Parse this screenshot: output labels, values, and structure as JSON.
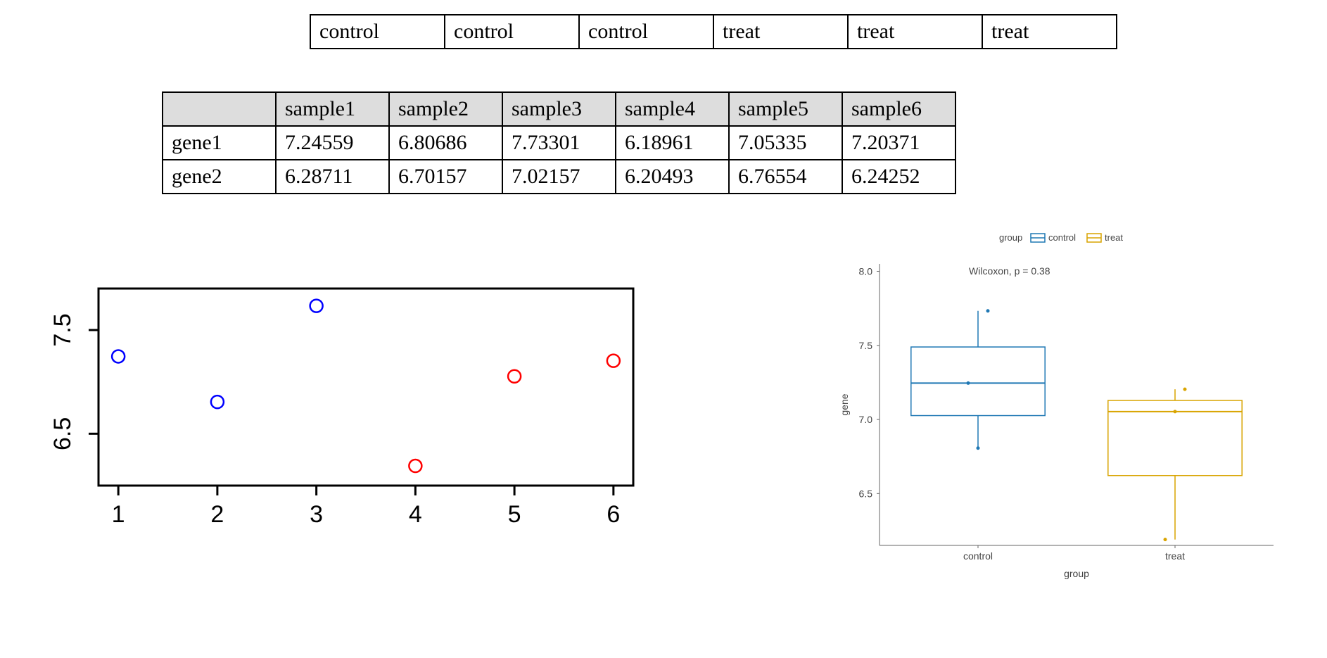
{
  "groups_table": {
    "cells": [
      "control",
      "control",
      "control",
      "treat",
      "treat",
      "treat"
    ]
  },
  "data_table": {
    "corner": "",
    "headers": [
      "sample1",
      "sample2",
      "sample3",
      "sample4",
      "sample5",
      "sample6"
    ],
    "rows": [
      {
        "label": "gene1",
        "values": [
          "7.24559",
          "6.80686",
          "7.73301",
          "6.18961",
          "7.05335",
          "7.20371"
        ]
      },
      {
        "label": "gene2",
        "values": [
          "6.28711",
          "6.70157",
          "7.02157",
          "6.20493",
          "6.76554",
          "6.24252"
        ]
      }
    ]
  },
  "chart_data": [
    {
      "id": "scatter",
      "type": "scatter",
      "x_ticks": [
        "1",
        "2",
        "3",
        "4",
        "5",
        "6"
      ],
      "y_ticks": [
        "6.5",
        "7.5"
      ],
      "x_range": [
        0.8,
        6.2
      ],
      "y_range": [
        6.0,
        7.9
      ],
      "series": [
        {
          "name": "control",
          "color": "#0000ff",
          "points": [
            [
              1,
              7.24559
            ],
            [
              2,
              6.80686
            ],
            [
              3,
              7.73301
            ]
          ]
        },
        {
          "name": "treat",
          "color": "#ff0000",
          "points": [
            [
              4,
              6.18961
            ],
            [
              5,
              7.05335
            ],
            [
              6,
              7.20371
            ]
          ]
        }
      ]
    },
    {
      "id": "boxplot",
      "type": "boxplot",
      "legend_title": "group",
      "annotation": "Wilcoxon, p = 0.38",
      "xlabel": "group",
      "ylabel": "gene",
      "y_ticks": [
        "6.5",
        "7.0",
        "7.5",
        "8.0"
      ],
      "y_range": [
        6.15,
        8.05
      ],
      "categories": [
        "control",
        "treat"
      ],
      "series": [
        {
          "name": "control",
          "color": "#1f78b4",
          "box": {
            "min": 6.80686,
            "q1": 7.02623,
            "median": 7.24559,
            "q3": 7.4893,
            "max": 7.73301
          },
          "points": [
            7.24559,
            6.80686,
            7.73301
          ]
        },
        {
          "name": "treat",
          "color": "#d9a400",
          "box": {
            "min": 6.18961,
            "q1": 6.62148,
            "median": 7.05335,
            "q3": 7.12853,
            "max": 7.20371
          },
          "points": [
            6.18961,
            7.05335,
            7.20371
          ]
        }
      ]
    }
  ]
}
